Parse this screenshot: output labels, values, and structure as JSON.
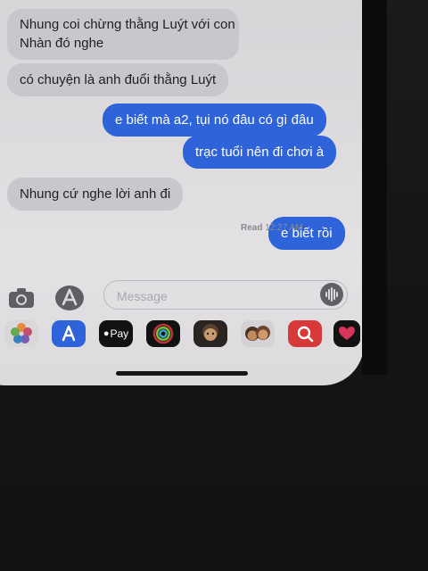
{
  "conversation": {
    "messages": [
      {
        "direction": "incoming",
        "lines": [
          "Nhung coi chừng thằng Luýt với con",
          "Nhàn đó nghe"
        ]
      },
      {
        "direction": "incoming",
        "lines": [
          "có chuyện là anh đuổi thằng Luýt"
        ]
      },
      {
        "direction": "outgoing",
        "lines": [
          "e biết mà a2, tụi nó đâu có gì đâu"
        ]
      },
      {
        "direction": "outgoing",
        "lines": [
          "trạc tuổi nên đi chơi à"
        ]
      },
      {
        "direction": "incoming",
        "lines": [
          "Nhung cứ nghe lời anh đi"
        ]
      },
      {
        "direction": "outgoing",
        "lines": [
          "e biết rồi"
        ]
      }
    ],
    "read_receipt": {
      "label": "Read",
      "time": "12:27 AM"
    }
  },
  "composer": {
    "placeholder": "Message",
    "value": "",
    "camera_icon": "camera-icon",
    "apps_icon": "app-store-icon",
    "audio_icon": "audio-waveform-icon"
  },
  "app_drawer": {
    "apps": [
      {
        "name": "photos-app-icon"
      },
      {
        "name": "app-store-app-icon"
      },
      {
        "name": "apple-pay-app-icon",
        "label": "Pay"
      },
      {
        "name": "activity-app-icon"
      },
      {
        "name": "memoji-app-icon"
      },
      {
        "name": "memoji-stickers-app-icon"
      },
      {
        "name": "search-images-app-icon"
      },
      {
        "name": "digital-touch-app-icon"
      }
    ]
  },
  "colors": {
    "outgoing_bubble": "#2f63d9",
    "incoming_bubble": "#c9c7cb",
    "screen_background": "#dddbde",
    "surround": "#141414"
  }
}
